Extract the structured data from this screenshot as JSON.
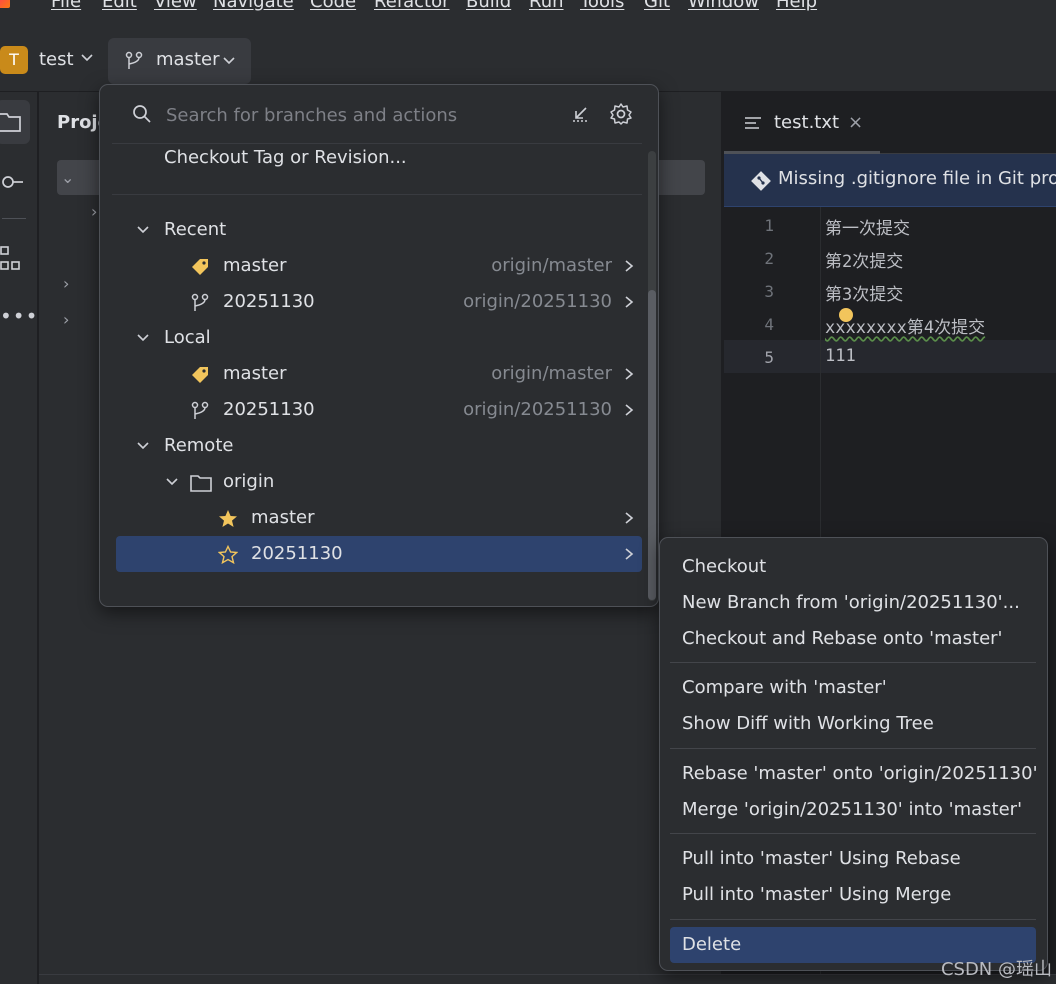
{
  "menubar": {
    "items": [
      "File",
      "Edit",
      "View",
      "Navigate",
      "Code",
      "Refactor",
      "Build",
      "Run",
      "Tools",
      "Git",
      "Window",
      "Help"
    ]
  },
  "toolbar": {
    "project_initial": "T",
    "project_name": "test",
    "branch": "master"
  },
  "project_panel": {
    "title": "Proje"
  },
  "editor": {
    "tab_label": "test.txt",
    "banner_text": "Missing .gitignore file in Git proj",
    "line_numbers": [
      "1",
      "2",
      "3",
      "4",
      "5"
    ],
    "lines": [
      "第一次提交",
      "第2次提交",
      "第3次提交",
      "xxxxxxxx第4次提交",
      "111"
    ]
  },
  "branch_popup": {
    "search_placeholder": "Search for branches and actions",
    "checkout_tag": "Checkout Tag or Revision...",
    "groups": {
      "recent": "Recent",
      "local": "Local",
      "remote": "Remote",
      "origin": "origin"
    },
    "recent": [
      {
        "name": "master",
        "tracking": "origin/master"
      },
      {
        "name": "20251130",
        "tracking": "origin/20251130"
      }
    ],
    "local": [
      {
        "name": "master",
        "tracking": "origin/master"
      },
      {
        "name": "20251130",
        "tracking": "origin/20251130"
      }
    ],
    "remote_origin": [
      {
        "name": "master"
      },
      {
        "name": "20251130"
      }
    ]
  },
  "context_menu": {
    "items": [
      "Checkout",
      "New Branch from 'origin/20251130'...",
      "Checkout and Rebase onto 'master'",
      "Compare with 'master'",
      "Show Diff with Working Tree",
      "Rebase 'master' onto 'origin/20251130'",
      "Merge 'origin/20251130' into 'master'",
      "Pull into 'master' Using Rebase",
      "Pull into 'master' Using Merge",
      "Delete"
    ],
    "selected": "Delete"
  },
  "watermark": "CSDN @瑶山",
  "colors": {
    "background": "#1e1f22",
    "panel": "#2b2d30",
    "selection": "#2e436e",
    "tag_icon": "#f2c55c",
    "project_badge": "#c98a1a"
  },
  "icons": [
    "search-icon",
    "collapse-icon",
    "gear-icon",
    "tag-icon",
    "branch-icon",
    "folder-icon",
    "star-filled-icon",
    "star-outline-icon",
    "chevron-right-icon",
    "chevron-down-icon"
  ]
}
